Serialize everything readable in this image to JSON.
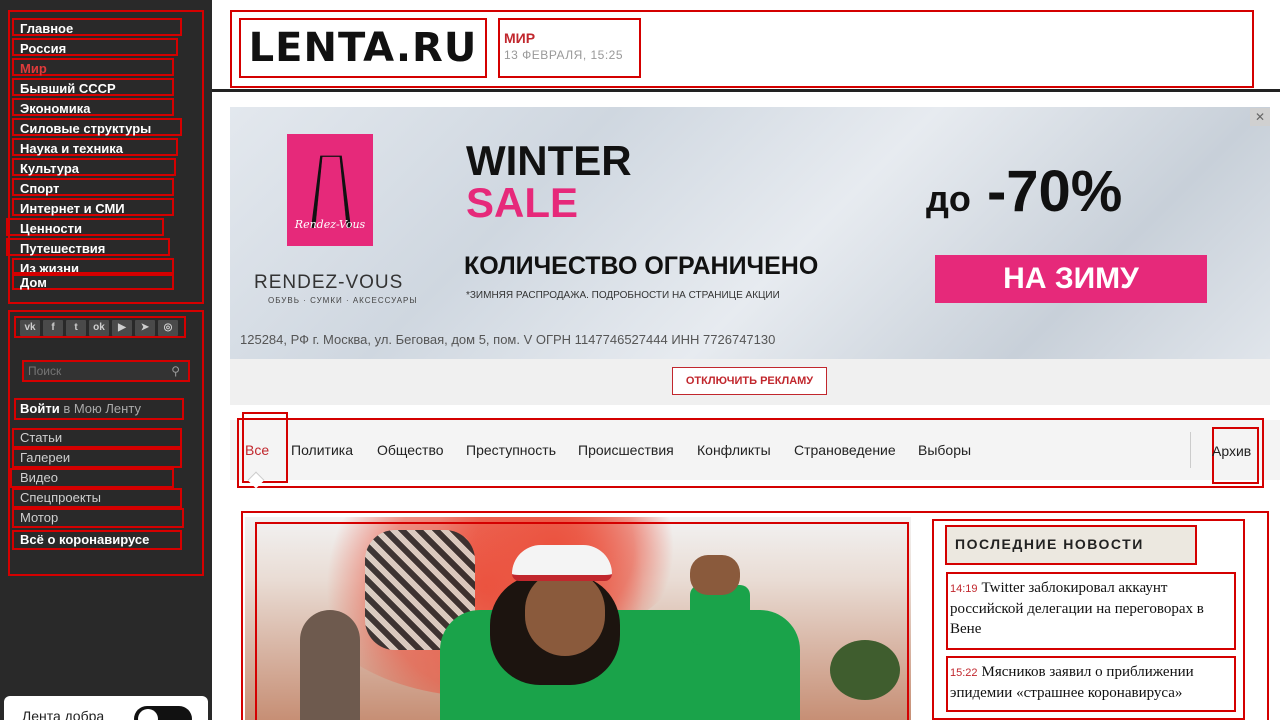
{
  "sidebar": {
    "nav": [
      "Главное",
      "Россия",
      "Мир",
      "Бывший СССР",
      "Экономика",
      "Силовые структуры",
      "Наука и техника",
      "Культура",
      "Спорт",
      "Интернет и СМИ",
      "Ценности",
      "Путешествия",
      "Из жизни",
      "Дом"
    ],
    "active_nav": "Мир",
    "social": [
      "vk",
      "f",
      "tw",
      "ok",
      "yt",
      "tg",
      "ig"
    ],
    "search_placeholder": "Поиск",
    "login_action": "Войти",
    "login_suffix": "в Мою Ленту",
    "links": [
      "Статьи",
      "Галереи",
      "Видео",
      "Спецпроекты",
      "Мотор"
    ],
    "bold_link": "Всё о коронавирусе",
    "toggle_label": "Лента добра"
  },
  "header": {
    "logo": "LENTA.RU",
    "rubric": "МИР",
    "date": "13 ФЕВРАЛЯ, 15:25"
  },
  "banner": {
    "brand_logo_text": "Rendez-Vous",
    "brand": "RENDEZ-VOUS",
    "brand_sub": "ОБУВЬ · СУМКИ · АКСЕССУАРЫ",
    "headline1": "WINTER",
    "headline2": "SALE",
    "limited": "КОЛИЧЕСТВО ОГРАНИЧЕНО",
    "fine_print": "*ЗИМНЯЯ РАСПРОДАЖА. ПОДРОБНОСТИ НА СТРАНИЦЕ АКЦИИ",
    "discount_prefix": "до",
    "discount": "-70%",
    "season": "НА ЗИМУ",
    "address": "125284, РФ г. Москва, ул. Беговая, дом 5, пом. V ОГРН 1147746527444 ИНН 7726747130",
    "close": "✕",
    "disable_ads": "ОТКЛЮЧИТЬ РЕКЛАМУ"
  },
  "tabs": [
    "Все",
    "Политика",
    "Общество",
    "Преступность",
    "Происшествия",
    "Конфликты",
    "Страноведение",
    "Выборы"
  ],
  "archive": "Архив",
  "latest": {
    "title": "ПОСЛЕДНИЕ НОВОСТИ",
    "items": [
      {
        "time": "14:19",
        "text": "Twitter заблокировал аккаунт российской делегации на переговорах в Вене"
      },
      {
        "time": "15:22",
        "text": "Мясников заявил о приближении эпидемии «страшнее коронавируса»"
      }
    ]
  },
  "colors": {
    "accent": "#c1272d",
    "sidebar_bg": "#292929",
    "brand_pink": "#e6297a"
  }
}
